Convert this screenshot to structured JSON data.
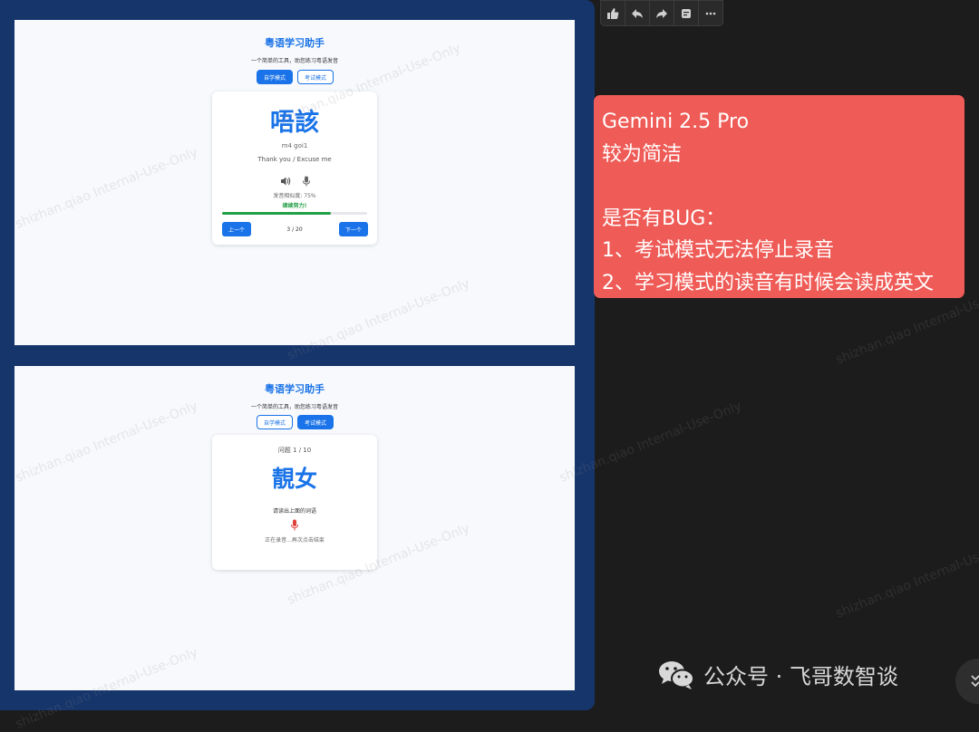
{
  "toolbar": {
    "icons": [
      "thumbs-up-icon",
      "reply-icon",
      "forward-icon",
      "sticker-icon",
      "more-icon"
    ]
  },
  "study_screen": {
    "title": "粤语学习助手",
    "subtitle": "一个简单的工具，助您练习粤语发音",
    "mode_study": "自学模式",
    "mode_exam": "考试模式",
    "word": "唔該",
    "romanization": "m4 goi1",
    "meaning": "Thank you / Excuse me",
    "similarity": "发音相似度: 75%",
    "feedback": "继续努力!",
    "progress": 0.75,
    "prev": "上一个",
    "counter": "3 / 20",
    "next": "下一个"
  },
  "exam_screen": {
    "title": "粤语学习助手",
    "subtitle": "一个简单的工具，助您练习粤语发音",
    "mode_study": "自学模式",
    "mode_exam": "考试模式",
    "question_counter": "问题 1 / 10",
    "word": "靚女",
    "prompt": "请读出上面的词语",
    "recording_status": "正在录音...再次点击结束"
  },
  "watermark": "shizhan.qiao Internal-Use-Only",
  "note": {
    "lines": [
      "Gemini 2.5 Pro",
      "较为简洁",
      "",
      "是否有BUG：",
      "1、考试模式无法停止录音",
      "2、学习模式的读音有时候会读成英文"
    ]
  },
  "footer": {
    "text": "公众号 · 飞哥数智谈"
  },
  "colors": {
    "accent": "#1a73e8",
    "progress": "#22a045",
    "mic_recording": "#e0403a",
    "note_bg": "#ef5b56",
    "panel_bg": "#16356b"
  }
}
